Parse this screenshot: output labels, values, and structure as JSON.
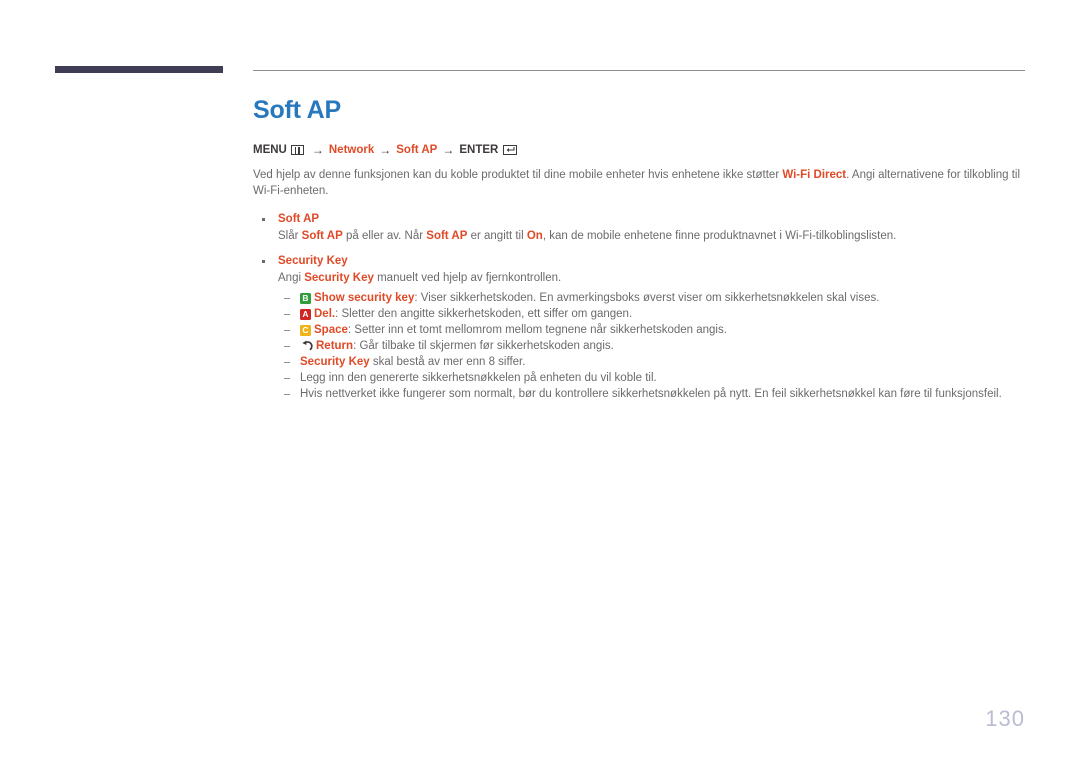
{
  "page": {
    "title": "Soft AP",
    "number": "130",
    "accent_color": "#e04a27",
    "title_color": "#2878be",
    "rule_color": "#3f3d56"
  },
  "menu_path": {
    "menu_label": "MENU",
    "menu_icon": "menu-grid-icon",
    "arrow": "→",
    "step1": "Network",
    "step2": "Soft AP",
    "enter_label": "ENTER",
    "enter_icon": "enter-key-icon"
  },
  "intro": {
    "part1": "Ved hjelp av denne funksjonen kan du koble produktet til dine mobile enheter hvis enhetene ikke støtter ",
    "bold1": "Wi-Fi Direct",
    "part2": ". Angi alternativene for tilkobling til Wi-Fi-enheten."
  },
  "bullets": [
    {
      "head": "Soft AP",
      "body_part1": "Slår ",
      "body_bold1": "Soft AP",
      "body_part2": " på eller av. Når ",
      "body_bold2": "Soft AP",
      "body_part3": " er angitt til ",
      "body_bold3": "On",
      "body_part4": ", kan de mobile enhetene finne produktnavnet i Wi-Fi-tilkoblingslisten."
    },
    {
      "head": "Security Key",
      "body_part1": "Angi ",
      "body_bold1": "Security Key",
      "body_part2": " manuelt ved hjelp av fjernkontrollen."
    }
  ],
  "sub_items": [
    {
      "icon": "key-b-green",
      "key_label": "B",
      "bold": "Show security key",
      "text": ": Viser sikkerhetskoden. En avmerkingsboks øverst viser om sikkerhetsnøkkelen skal vises."
    },
    {
      "icon": "key-a-red",
      "key_label": "A",
      "bold": "Del.",
      "text": ": Sletter den angitte sikkerhetskoden, ett siffer om gangen."
    },
    {
      "icon": "key-c-yellow",
      "key_label": "C",
      "bold": "Space",
      "text": ": Setter inn et tomt mellomrom mellom tegnene når sikkerhetskoden angis."
    },
    {
      "icon": "return-arrow-icon",
      "key_label": "",
      "bold": "Return",
      "text": ": Går tilbake til skjermen før sikkerhetskoden angis."
    },
    {
      "icon": "",
      "key_label": "",
      "bold": "Security Key",
      "text": " skal bestå av mer enn 8 siffer."
    },
    {
      "icon": "",
      "key_label": "",
      "bold": "",
      "text": "Legg inn den genererte sikkerhetsnøkkelen på enheten du vil koble til."
    },
    {
      "icon": "",
      "key_label": "",
      "bold": "",
      "text": "Hvis nettverket ikke fungerer som normalt, bør du kontrollere sikkerhetsnøkkelen på nytt. En feil sikkerhetsnøkkel kan føre til funksjonsfeil."
    }
  ]
}
